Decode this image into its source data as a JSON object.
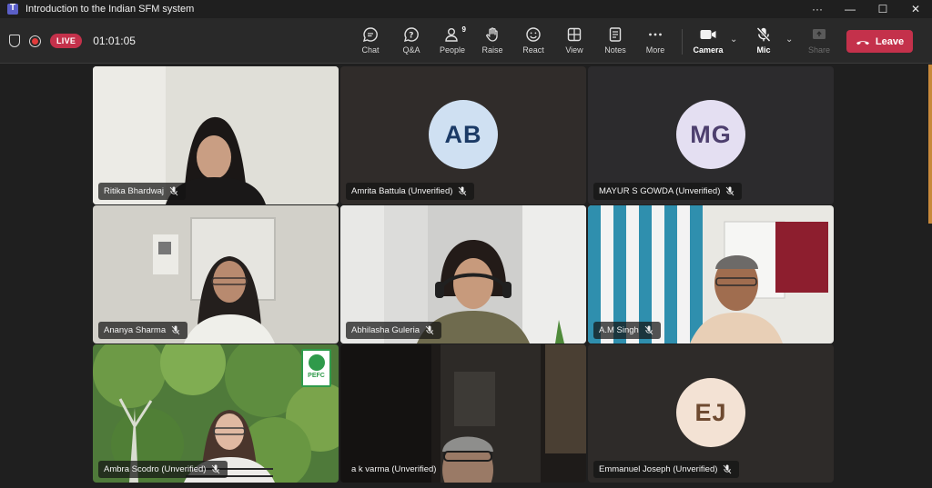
{
  "window": {
    "title": "Introduction to the Indian SFM system",
    "controls": [
      "···",
      "—",
      "☐",
      "✕"
    ]
  },
  "meeting": {
    "live_label": "LIVE",
    "timer": "01:01:05",
    "people_count": "9",
    "toolbar": {
      "chat": "Chat",
      "qa": "Q&A",
      "people": "People",
      "raise": "Raise",
      "react": "React",
      "view": "View",
      "notes": "Notes",
      "more": "More",
      "camera": "Camera",
      "mic": "Mic",
      "share": "Share",
      "leave": "Leave"
    }
  },
  "participants": [
    {
      "name": "Ritika Bhardwaj",
      "type": "video"
    },
    {
      "name": "Amrita Battula (Unverified)",
      "type": "avatar",
      "initials": "AB",
      "avatar_bg": "#cfe0f2",
      "avatar_fg": "#1b3a66"
    },
    {
      "name": "MAYUR S GOWDA (Unverified)",
      "type": "avatar",
      "initials": "MG",
      "avatar_bg": "#e4dff2",
      "avatar_fg": "#4d3f6e"
    },
    {
      "name": "Ananya Sharma",
      "type": "video"
    },
    {
      "name": "Abhilasha Guleria",
      "type": "video"
    },
    {
      "name": "A.M Singh",
      "type": "video"
    },
    {
      "name": "Ambra Scodro (Unverified)",
      "type": "video",
      "badge": "PEFC"
    },
    {
      "name": "a k varma (Unverified)",
      "type": "video"
    },
    {
      "name": "Emmanuel Joseph (Unverified)",
      "type": "avatar",
      "initials": "EJ",
      "avatar_bg": "#f3e2d4",
      "avatar_fg": "#6e4a30"
    }
  ],
  "colors": {
    "accent_leave": "#c4314b",
    "live_badge": "#c4314b",
    "background": "#1f1f1f"
  }
}
